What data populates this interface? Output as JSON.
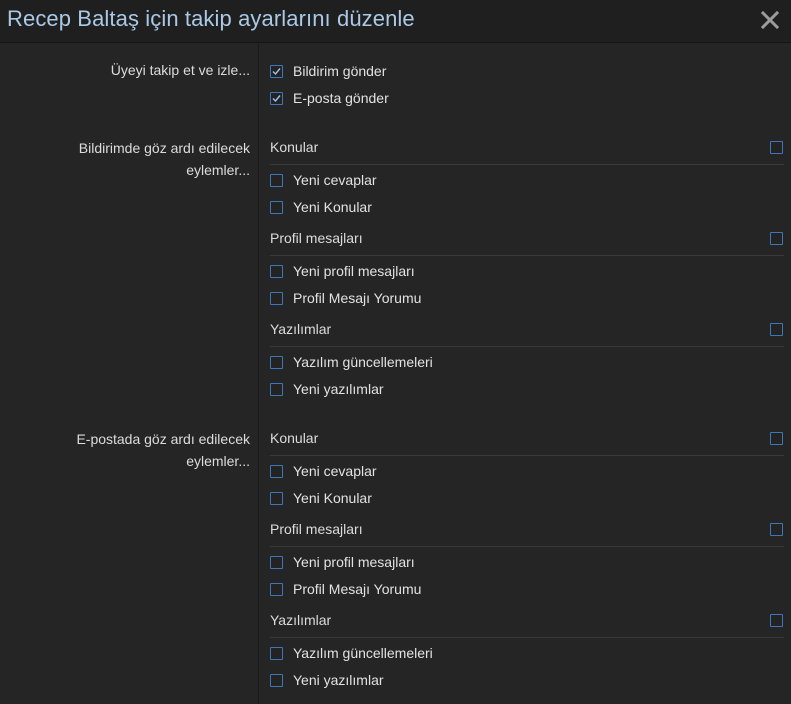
{
  "dialog": {
    "title": "Recep Baltaş için takip ayarlarını düzenle"
  },
  "follow": {
    "label": "Üyeyi takip et ve izle...",
    "options": [
      {
        "label": "Bildirim gönder",
        "checked": true
      },
      {
        "label": "E-posta gönder",
        "checked": true
      }
    ]
  },
  "alert_ignore": {
    "label_line1": "Bildirimde göz ardı edilecek",
    "label_line2": "eylemler...",
    "groups": [
      {
        "title": "Konular",
        "items": [
          "Yeni cevaplar",
          "Yeni Konular"
        ]
      },
      {
        "title": "Profil mesajları",
        "items": [
          "Yeni profil mesajları",
          "Profil Mesajı Yorumu"
        ]
      },
      {
        "title": "Yazılımlar",
        "items": [
          "Yazılım güncellemeleri",
          "Yeni yazılımlar"
        ]
      }
    ]
  },
  "email_ignore": {
    "label_line1": "E-postada göz ardı edilecek",
    "label_line2": "eylemler...",
    "groups": [
      {
        "title": "Konular",
        "items": [
          "Yeni cevaplar",
          "Yeni Konular"
        ]
      },
      {
        "title": "Profil mesajları",
        "items": [
          "Yeni profil mesajları",
          "Profil Mesajı Yorumu"
        ]
      },
      {
        "title": "Yazılımlar",
        "items": [
          "Yazılım güncellemeleri",
          "Yeni yazılımlar"
        ]
      }
    ]
  },
  "icons": {
    "close": "close-icon",
    "checkbox_checked": "checkmark-icon"
  },
  "colors": {
    "title": "#a9c9e6",
    "checkbox_border": "#3d77b8",
    "background": "#252525"
  }
}
